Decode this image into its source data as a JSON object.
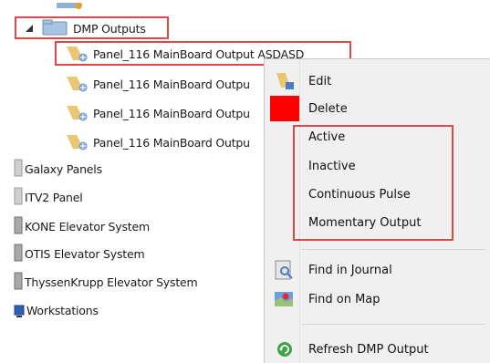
{
  "tree": {
    "dmp_outputs": "DMP Outputs",
    "panels": [
      "Panel_116 MainBoard Output ASDASD",
      "Panel_116 MainBoard Outpu",
      "Panel_116 MainBoard Outpu",
      "Panel_116 MainBoard Outpu"
    ],
    "systems": [
      {
        "label": "Galaxy Panels",
        "icon": "panel-icon"
      },
      {
        "label": "ITV2 Panel",
        "icon": "panel-icon"
      },
      {
        "label": "KONE Elevator System",
        "icon": "elevator-icon"
      },
      {
        "label": "OTIS Elevator System",
        "icon": "elevator-icon"
      },
      {
        "label": "ThyssenKrupp Elevator System",
        "icon": "elevator-icon"
      },
      {
        "label": "Workstations",
        "icon": "workstation-icon"
      }
    ]
  },
  "context_menu": {
    "edit": "Edit",
    "delete": "Delete",
    "active": "Active",
    "inactive": "Inactive",
    "continuous_pulse": "Continuous Pulse",
    "momentary_output": "Momentary Output",
    "find_in_journal": "Find in Journal",
    "find_on_map": "Find on Map",
    "refresh": "Refresh DMP Output"
  },
  "colors": {
    "highlight": "#e04848",
    "delete_swatch": "#ff0000",
    "menu_bg": "#f0f0f0"
  }
}
